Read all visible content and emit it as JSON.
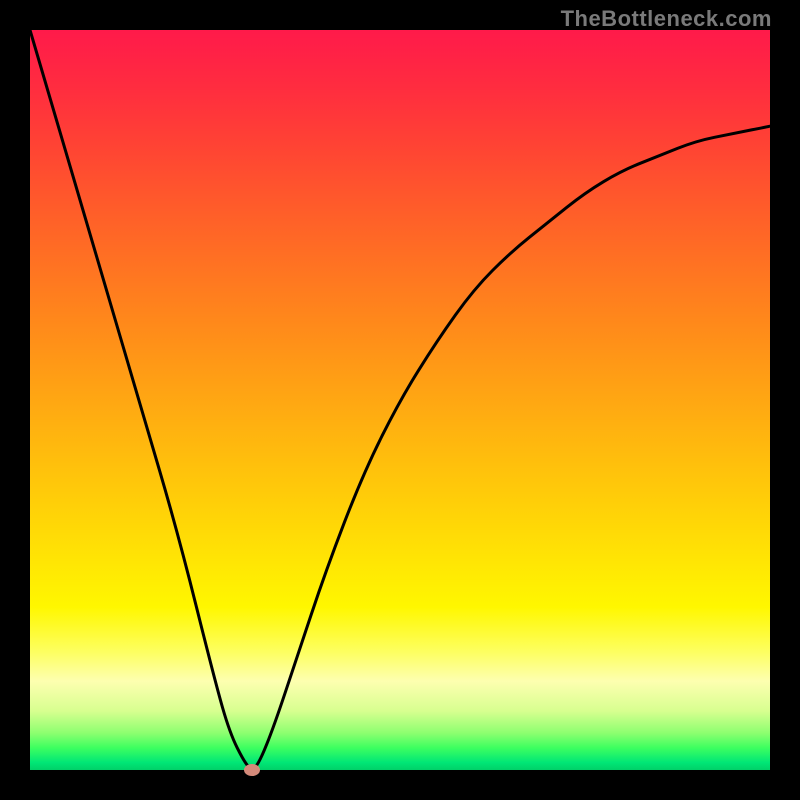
{
  "watermark": "TheBottleneck.com",
  "chart_data": {
    "type": "line",
    "title": "",
    "xlabel": "",
    "ylabel": "",
    "xlim": [
      0,
      100
    ],
    "ylim": [
      0,
      100
    ],
    "grid": false,
    "background": "red-to-green vertical gradient",
    "series": [
      {
        "name": "bottleneck-curve",
        "x": [
          0,
          5,
          10,
          15,
          20,
          25,
          27,
          29,
          30,
          31,
          33,
          36,
          40,
          45,
          50,
          55,
          60,
          65,
          70,
          75,
          80,
          85,
          90,
          95,
          100
        ],
        "y": [
          100,
          83,
          66,
          49,
          32,
          12,
          5,
          1,
          0,
          1,
          6,
          15,
          27,
          40,
          50,
          58,
          65,
          70,
          74,
          78,
          81,
          83,
          85,
          86,
          87
        ]
      }
    ],
    "marker": {
      "x": 30,
      "y": 0,
      "color": "#d48a7a"
    }
  }
}
